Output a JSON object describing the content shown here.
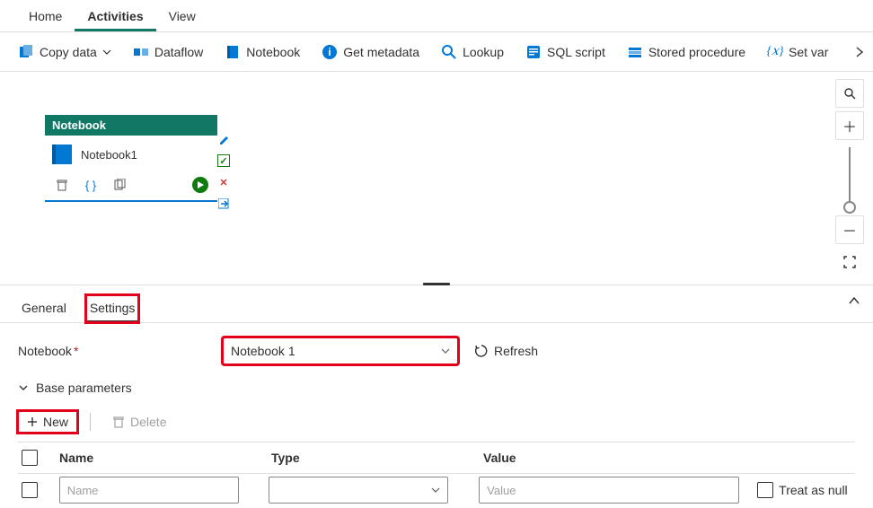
{
  "nav": {
    "tabs": [
      {
        "label": "Home",
        "active": false
      },
      {
        "label": "Activities",
        "active": true
      },
      {
        "label": "View",
        "active": false
      }
    ]
  },
  "toolbar": {
    "items": [
      {
        "label": "Copy data",
        "icon": "copy-data",
        "hasDropdown": true
      },
      {
        "label": "Dataflow",
        "icon": "dataflow"
      },
      {
        "label": "Notebook",
        "icon": "notebook"
      },
      {
        "label": "Get metadata",
        "icon": "info"
      },
      {
        "label": "Lookup",
        "icon": "search"
      },
      {
        "label": "SQL script",
        "icon": "sql"
      },
      {
        "label": "Stored procedure",
        "icon": "stored-proc"
      },
      {
        "label": "Set var",
        "icon": "variable"
      }
    ]
  },
  "node": {
    "header": "Notebook",
    "title": "Notebook1"
  },
  "panel": {
    "tabs": [
      {
        "label": "General",
        "active": false
      },
      {
        "label": "Settings",
        "active": true
      }
    ],
    "notebook_label": "Notebook",
    "notebook_value": "Notebook 1",
    "refresh_label": "Refresh",
    "section_label": "Base parameters",
    "btn_new": "New",
    "btn_delete": "Delete",
    "table": {
      "headers": {
        "name": "Name",
        "type": "Type",
        "value": "Value"
      },
      "row": {
        "name_placeholder": "Name",
        "value_placeholder": "Value",
        "null_label": "Treat as null"
      }
    }
  }
}
